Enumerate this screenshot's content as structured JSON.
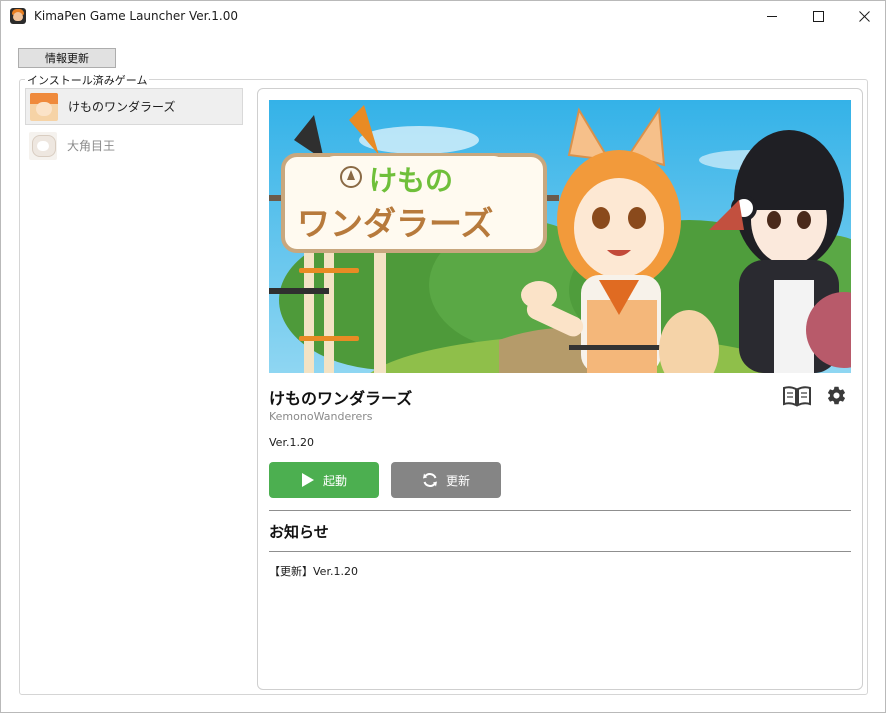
{
  "window": {
    "title": "KimaPen Game Launcher Ver.1.00",
    "icon": "app-icon",
    "controls": [
      "minimize-icon",
      "maximize-icon",
      "close-icon"
    ]
  },
  "toolbar": {
    "refresh_label": "情報更新"
  },
  "installed_group": {
    "legend": "インストール済みゲーム",
    "games": [
      {
        "label": "けものワンダラーズ",
        "selected": true
      },
      {
        "label": "大角目王",
        "selected": false
      }
    ]
  },
  "detail": {
    "title": "けものワンダラーズ",
    "subtitle": "KemonoWanderers",
    "version": "Ver.1.20",
    "launch_label": "起動",
    "update_label": "更新",
    "news_heading": "お知らせ",
    "news_items": [
      "【更新】Ver.1.20"
    ],
    "banner_logo_line1": "けもの",
    "banner_logo_line2": "ワンダラーズ",
    "icons": [
      "book-icon",
      "gear-icon"
    ]
  },
  "colors": {
    "launch_button": "#4caf50",
    "update_button": "#858585",
    "sky": "#36b4e8"
  }
}
